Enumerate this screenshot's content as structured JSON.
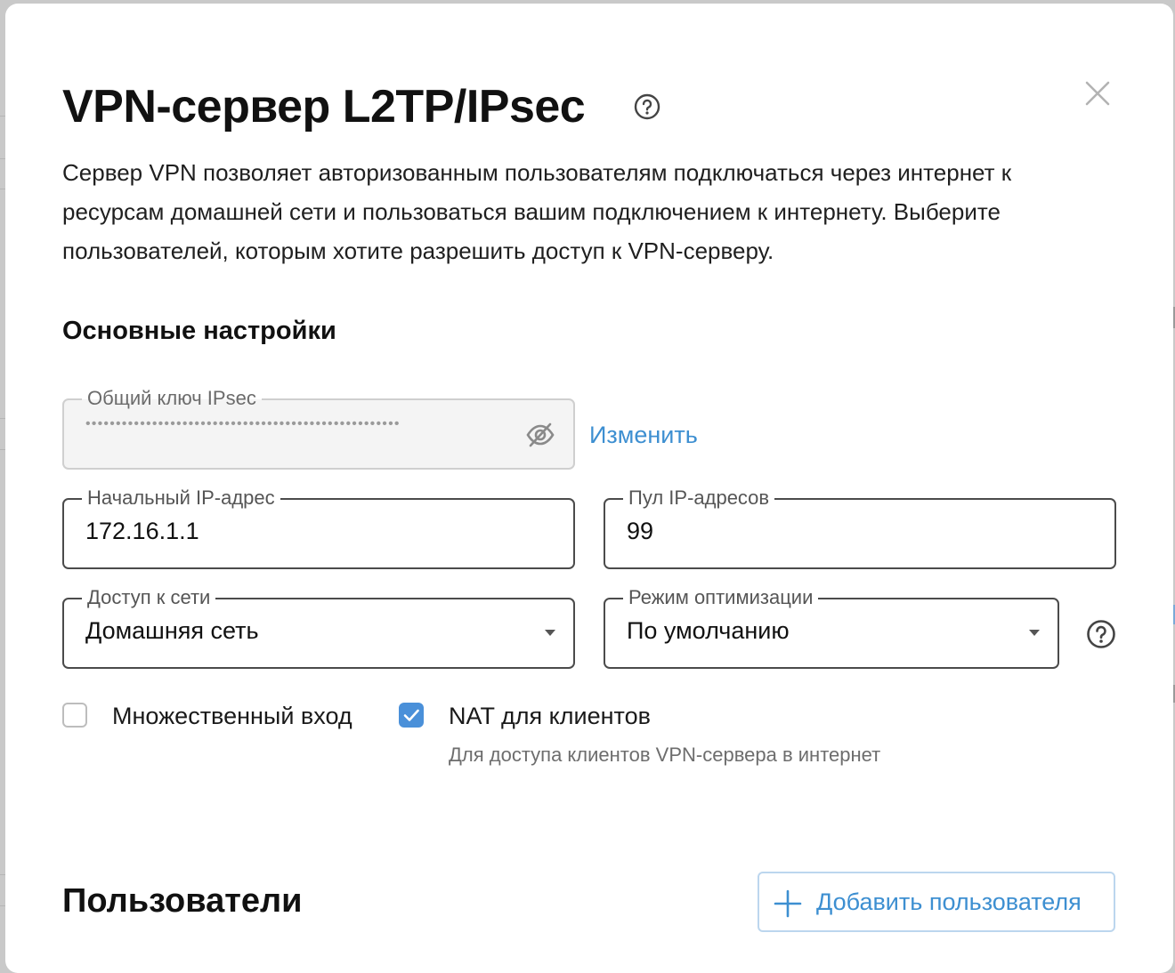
{
  "dialog": {
    "title": "VPN-сервер L2TP/IPsec",
    "description_lines": [
      "Сервер VPN позволяет авторизованным пользователям подключаться через интернет к",
      "ресурсам домашней сети и пользоваться вашим подключением к интернету. Выберите",
      "пользователей, которым хотите разрешить доступ к VPN-серверу."
    ]
  },
  "basic_settings": {
    "heading": "Основные настройки",
    "psk": {
      "label": "Общий ключ IPsec",
      "masked_value": "••••••••••••••••••••••••••••••••••••••••••••••••••••",
      "change_link": "Изменить"
    },
    "start_ip": {
      "label": "Начальный IP-адрес",
      "value": "172.16.1.1"
    },
    "ip_pool": {
      "label": "Пул IP-адресов",
      "value": "99"
    },
    "network_access": {
      "label": "Доступ к сети",
      "value": "Домашняя сеть"
    },
    "optimization_mode": {
      "label": "Режим оптимизации",
      "value": "По умолчанию"
    },
    "multi_login": {
      "label": "Множественный вход",
      "checked": false
    },
    "nat": {
      "label": "NAT для клиентов",
      "hint": "Для доступа клиентов VPN-сервера в интернет",
      "checked": true
    }
  },
  "users": {
    "heading": "Пользователи",
    "add_button": "Добавить пользователя"
  },
  "colors": {
    "accent": "#3d8fd1",
    "checkbox_on": "#4a90d9",
    "field_border": "#4b4b4b",
    "backdrop": "#c9c9c9"
  },
  "icons": [
    "help-icon",
    "close-icon",
    "eye-off-icon",
    "chevron-down-icon",
    "check-icon",
    "plus-icon"
  ]
}
